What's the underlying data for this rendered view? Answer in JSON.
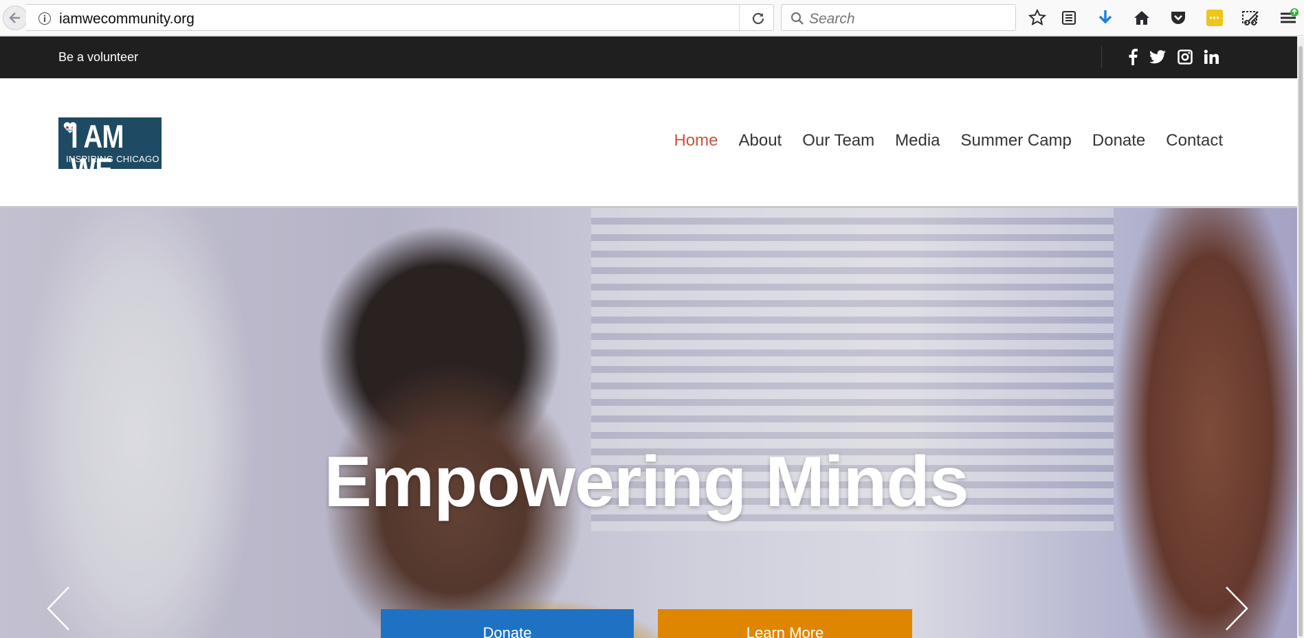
{
  "browser": {
    "url": "iamwecommunity.org",
    "search_placeholder": "Search",
    "icons": [
      "back-icon",
      "info-icon",
      "reload-icon",
      "search-icon",
      "bookmark-star-icon",
      "reader-view-icon",
      "download-icon",
      "home-icon",
      "pocket-icon",
      "extension-icon",
      "screenshot-icon",
      "menu-icon"
    ],
    "accent_download": "#1e7ee6"
  },
  "topbar": {
    "volunteer_label": "Be a volunteer",
    "social": [
      "facebook-icon",
      "twitter-icon",
      "instagram-icon",
      "linkedin-icon"
    ]
  },
  "logo": {
    "big": "I AM WE",
    "small": "INSPIRING CHICAGO"
  },
  "nav": {
    "items": [
      "Home",
      "About",
      "Our Team",
      "Media",
      "Summer Camp",
      "Donate",
      "Contact"
    ],
    "active": "Home",
    "active_color": "#c8553d"
  },
  "hero": {
    "title": "Empowering Minds",
    "donate_label": "Donate",
    "learn_more_label": "Learn More",
    "donate_color": "#1f71c4",
    "learn_more_color": "#df8600"
  }
}
